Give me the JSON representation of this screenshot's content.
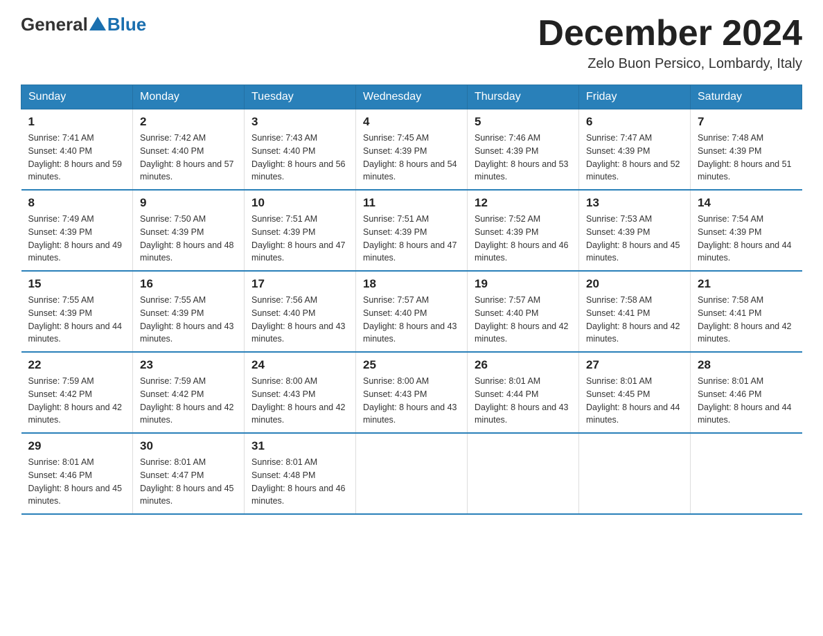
{
  "header": {
    "logo_general": "General",
    "logo_blue": "Blue",
    "month_title": "December 2024",
    "location": "Zelo Buon Persico, Lombardy, Italy"
  },
  "days_of_week": [
    "Sunday",
    "Monday",
    "Tuesday",
    "Wednesday",
    "Thursday",
    "Friday",
    "Saturday"
  ],
  "weeks": [
    [
      {
        "day": "1",
        "sunrise": "7:41 AM",
        "sunset": "4:40 PM",
        "daylight": "8 hours and 59 minutes."
      },
      {
        "day": "2",
        "sunrise": "7:42 AM",
        "sunset": "4:40 PM",
        "daylight": "8 hours and 57 minutes."
      },
      {
        "day": "3",
        "sunrise": "7:43 AM",
        "sunset": "4:40 PM",
        "daylight": "8 hours and 56 minutes."
      },
      {
        "day": "4",
        "sunrise": "7:45 AM",
        "sunset": "4:39 PM",
        "daylight": "8 hours and 54 minutes."
      },
      {
        "day": "5",
        "sunrise": "7:46 AM",
        "sunset": "4:39 PM",
        "daylight": "8 hours and 53 minutes."
      },
      {
        "day": "6",
        "sunrise": "7:47 AM",
        "sunset": "4:39 PM",
        "daylight": "8 hours and 52 minutes."
      },
      {
        "day": "7",
        "sunrise": "7:48 AM",
        "sunset": "4:39 PM",
        "daylight": "8 hours and 51 minutes."
      }
    ],
    [
      {
        "day": "8",
        "sunrise": "7:49 AM",
        "sunset": "4:39 PM",
        "daylight": "8 hours and 49 minutes."
      },
      {
        "day": "9",
        "sunrise": "7:50 AM",
        "sunset": "4:39 PM",
        "daylight": "8 hours and 48 minutes."
      },
      {
        "day": "10",
        "sunrise": "7:51 AM",
        "sunset": "4:39 PM",
        "daylight": "8 hours and 47 minutes."
      },
      {
        "day": "11",
        "sunrise": "7:51 AM",
        "sunset": "4:39 PM",
        "daylight": "8 hours and 47 minutes."
      },
      {
        "day": "12",
        "sunrise": "7:52 AM",
        "sunset": "4:39 PM",
        "daylight": "8 hours and 46 minutes."
      },
      {
        "day": "13",
        "sunrise": "7:53 AM",
        "sunset": "4:39 PM",
        "daylight": "8 hours and 45 minutes."
      },
      {
        "day": "14",
        "sunrise": "7:54 AM",
        "sunset": "4:39 PM",
        "daylight": "8 hours and 44 minutes."
      }
    ],
    [
      {
        "day": "15",
        "sunrise": "7:55 AM",
        "sunset": "4:39 PM",
        "daylight": "8 hours and 44 minutes."
      },
      {
        "day": "16",
        "sunrise": "7:55 AM",
        "sunset": "4:39 PM",
        "daylight": "8 hours and 43 minutes."
      },
      {
        "day": "17",
        "sunrise": "7:56 AM",
        "sunset": "4:40 PM",
        "daylight": "8 hours and 43 minutes."
      },
      {
        "day": "18",
        "sunrise": "7:57 AM",
        "sunset": "4:40 PM",
        "daylight": "8 hours and 43 minutes."
      },
      {
        "day": "19",
        "sunrise": "7:57 AM",
        "sunset": "4:40 PM",
        "daylight": "8 hours and 42 minutes."
      },
      {
        "day": "20",
        "sunrise": "7:58 AM",
        "sunset": "4:41 PM",
        "daylight": "8 hours and 42 minutes."
      },
      {
        "day": "21",
        "sunrise": "7:58 AM",
        "sunset": "4:41 PM",
        "daylight": "8 hours and 42 minutes."
      }
    ],
    [
      {
        "day": "22",
        "sunrise": "7:59 AM",
        "sunset": "4:42 PM",
        "daylight": "8 hours and 42 minutes."
      },
      {
        "day": "23",
        "sunrise": "7:59 AM",
        "sunset": "4:42 PM",
        "daylight": "8 hours and 42 minutes."
      },
      {
        "day": "24",
        "sunrise": "8:00 AM",
        "sunset": "4:43 PM",
        "daylight": "8 hours and 42 minutes."
      },
      {
        "day": "25",
        "sunrise": "8:00 AM",
        "sunset": "4:43 PM",
        "daylight": "8 hours and 43 minutes."
      },
      {
        "day": "26",
        "sunrise": "8:01 AM",
        "sunset": "4:44 PM",
        "daylight": "8 hours and 43 minutes."
      },
      {
        "day": "27",
        "sunrise": "8:01 AM",
        "sunset": "4:45 PM",
        "daylight": "8 hours and 44 minutes."
      },
      {
        "day": "28",
        "sunrise": "8:01 AM",
        "sunset": "4:46 PM",
        "daylight": "8 hours and 44 minutes."
      }
    ],
    [
      {
        "day": "29",
        "sunrise": "8:01 AM",
        "sunset": "4:46 PM",
        "daylight": "8 hours and 45 minutes."
      },
      {
        "day": "30",
        "sunrise": "8:01 AM",
        "sunset": "4:47 PM",
        "daylight": "8 hours and 45 minutes."
      },
      {
        "day": "31",
        "sunrise": "8:01 AM",
        "sunset": "4:48 PM",
        "daylight": "8 hours and 46 minutes."
      },
      null,
      null,
      null,
      null
    ]
  ],
  "labels": {
    "sunrise": "Sunrise:",
    "sunset": "Sunset:",
    "daylight": "Daylight:"
  }
}
